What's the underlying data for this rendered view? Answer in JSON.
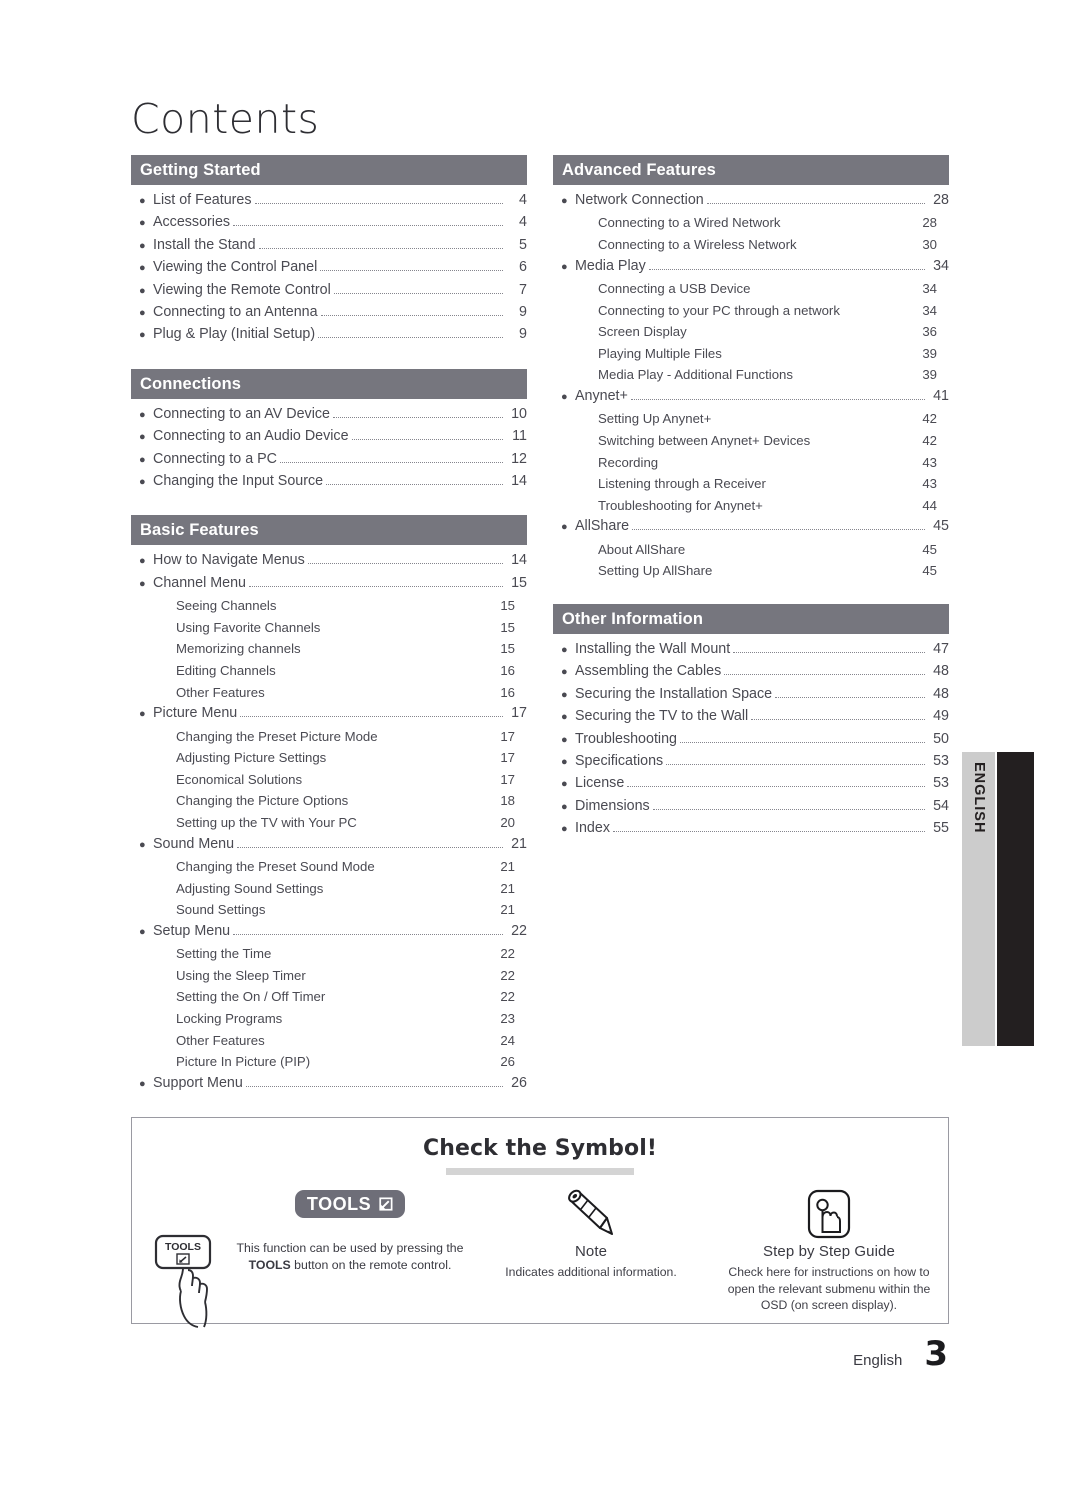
{
  "page": {
    "title": "Contents",
    "side_tab_label": "ENGLISH",
    "footer_language": "English",
    "footer_page_number": "3",
    "header_bar_color": "#76767e",
    "side_tab_light_color": "#cccccc",
    "side_tab_dark_color": "#231f20"
  },
  "columns": {
    "left": [
      {
        "header": "Getting Started",
        "entries": [
          {
            "level": 1,
            "title": "List of Features",
            "page": "4"
          },
          {
            "level": 1,
            "title": "Accessories",
            "page": "4"
          },
          {
            "level": 1,
            "title": "Install the Stand",
            "page": "5"
          },
          {
            "level": 1,
            "title": "Viewing the Control Panel",
            "page": "6"
          },
          {
            "level": 1,
            "title": "Viewing the Remote Control",
            "page": "7"
          },
          {
            "level": 1,
            "title": "Connecting to an Antenna",
            "page": "9"
          },
          {
            "level": 1,
            "title": "Plug & Play (Initial Setup)",
            "page": "9"
          }
        ]
      },
      {
        "header": "Connections",
        "entries": [
          {
            "level": 1,
            "title": "Connecting to an AV Device",
            "page": "10"
          },
          {
            "level": 1,
            "title": "Connecting to an Audio Device",
            "page": "11"
          },
          {
            "level": 1,
            "title": "Connecting to a PC",
            "page": "12"
          },
          {
            "level": 1,
            "title": "Changing the Input Source",
            "page": "14"
          }
        ]
      },
      {
        "header": "Basic Features",
        "entries": [
          {
            "level": 1,
            "title": "How to Navigate Menus",
            "page": "14"
          },
          {
            "level": 1,
            "title": "Channel Menu",
            "page": "15"
          },
          {
            "level": 2,
            "title": "Seeing Channels",
            "page": "15"
          },
          {
            "level": 2,
            "title": "Using Favorite Channels",
            "page": "15"
          },
          {
            "level": 2,
            "title": "Memorizing channels",
            "page": "15"
          },
          {
            "level": 2,
            "title": "Editing Channels",
            "page": "16"
          },
          {
            "level": 2,
            "title": "Other Features",
            "page": "16"
          },
          {
            "level": 1,
            "title": "Picture Menu",
            "page": "17"
          },
          {
            "level": 2,
            "title": "Changing the Preset Picture Mode",
            "page": "17"
          },
          {
            "level": 2,
            "title": "Adjusting Picture Settings",
            "page": "17"
          },
          {
            "level": 2,
            "title": "Economical Solutions",
            "page": "17"
          },
          {
            "level": 2,
            "title": "Changing the Picture Options",
            "page": "18"
          },
          {
            "level": 2,
            "title": "Setting up the TV with Your PC",
            "page": "20"
          },
          {
            "level": 1,
            "title": "Sound Menu",
            "page": "21"
          },
          {
            "level": 2,
            "title": "Changing the Preset Sound Mode",
            "page": "21"
          },
          {
            "level": 2,
            "title": "Adjusting Sound Settings",
            "page": "21"
          },
          {
            "level": 2,
            "title": "Sound Settings",
            "page": "21"
          },
          {
            "level": 1,
            "title": "Setup Menu",
            "page": "22"
          },
          {
            "level": 2,
            "title": "Setting the Time",
            "page": "22"
          },
          {
            "level": 2,
            "title": "Using the Sleep Timer",
            "page": "22"
          },
          {
            "level": 2,
            "title": "Setting the On / Off Timer",
            "page": "22"
          },
          {
            "level": 2,
            "title": "Locking Programs",
            "page": "23"
          },
          {
            "level": 2,
            "title": "Other Features",
            "page": "24"
          },
          {
            "level": 2,
            "title": "Picture In Picture (PIP)",
            "page": "26"
          },
          {
            "level": 1,
            "title": "Support Menu",
            "page": "26"
          }
        ]
      }
    ],
    "right": [
      {
        "header": "Advanced Features",
        "entries": [
          {
            "level": 1,
            "title": "Network Connection",
            "page": "28"
          },
          {
            "level": 2,
            "title": "Connecting to a Wired Network",
            "page": "28"
          },
          {
            "level": 2,
            "title": "Connecting to a Wireless Network",
            "page": "30"
          },
          {
            "level": 1,
            "title": "Media Play",
            "page": "34"
          },
          {
            "level": 2,
            "title": "Connecting a USB Device",
            "page": "34"
          },
          {
            "level": 2,
            "title": "Connecting to your PC through a network",
            "page": "34"
          },
          {
            "level": 2,
            "title": "Screen Display",
            "page": "36"
          },
          {
            "level": 2,
            "title": "Playing Multiple Files",
            "page": "39"
          },
          {
            "level": 2,
            "title": "Media Play - Additional Functions",
            "page": "39"
          },
          {
            "level": 1,
            "title": "Anynet+",
            "page": "41"
          },
          {
            "level": 2,
            "title": "Setting Up Anynet+",
            "page": "42"
          },
          {
            "level": 2,
            "title": "Switching between Anynet+ Devices",
            "page": "42"
          },
          {
            "level": 2,
            "title": "Recording",
            "page": "43"
          },
          {
            "level": 2,
            "title": "Listening through a Receiver",
            "page": "43"
          },
          {
            "level": 2,
            "title": "Troubleshooting for Anynet+",
            "page": "44"
          },
          {
            "level": 1,
            "title": "AllShare",
            "page": "45"
          },
          {
            "level": 2,
            "title": "About AllShare",
            "page": "45"
          },
          {
            "level": 2,
            "title": "Setting Up AllShare",
            "page": "45"
          }
        ]
      },
      {
        "header": "Other Information",
        "entries": [
          {
            "level": 1,
            "title": "Installing the Wall Mount",
            "page": "47"
          },
          {
            "level": 1,
            "title": "Assembling the Cables",
            "page": "48"
          },
          {
            "level": 1,
            "title": "Securing the Installation Space",
            "page": "48"
          },
          {
            "level": 1,
            "title": "Securing the TV to the Wall",
            "page": "49"
          },
          {
            "level": 1,
            "title": "Troubleshooting",
            "page": "50"
          },
          {
            "level": 1,
            "title": "Specifications",
            "page": "53"
          },
          {
            "level": 1,
            "title": "License",
            "page": "53"
          },
          {
            "level": 1,
            "title": "Dimensions",
            "page": "54"
          },
          {
            "level": 1,
            "title": "Index",
            "page": "55"
          }
        ]
      }
    ]
  },
  "symbol_box": {
    "title": "Check the Symbol!",
    "items": [
      {
        "icon": "tools-badge-icon",
        "badge_text": "TOOLS",
        "remote_key_text": "TOOLS",
        "label": "",
        "desc_line1_a": "This function can be used by pressing the",
        "desc_line2_bold": "TOOLS",
        "desc_line2_rest": "button on the remote control."
      },
      {
        "icon": "pencil-icon",
        "label": "Note",
        "desc": "Indicates additional information."
      },
      {
        "icon": "hand-press-icon",
        "label": "Step by Step Guide",
        "desc": "Check here for instructions on how to open the relevant submenu within the OSD (on screen display)."
      }
    ]
  }
}
